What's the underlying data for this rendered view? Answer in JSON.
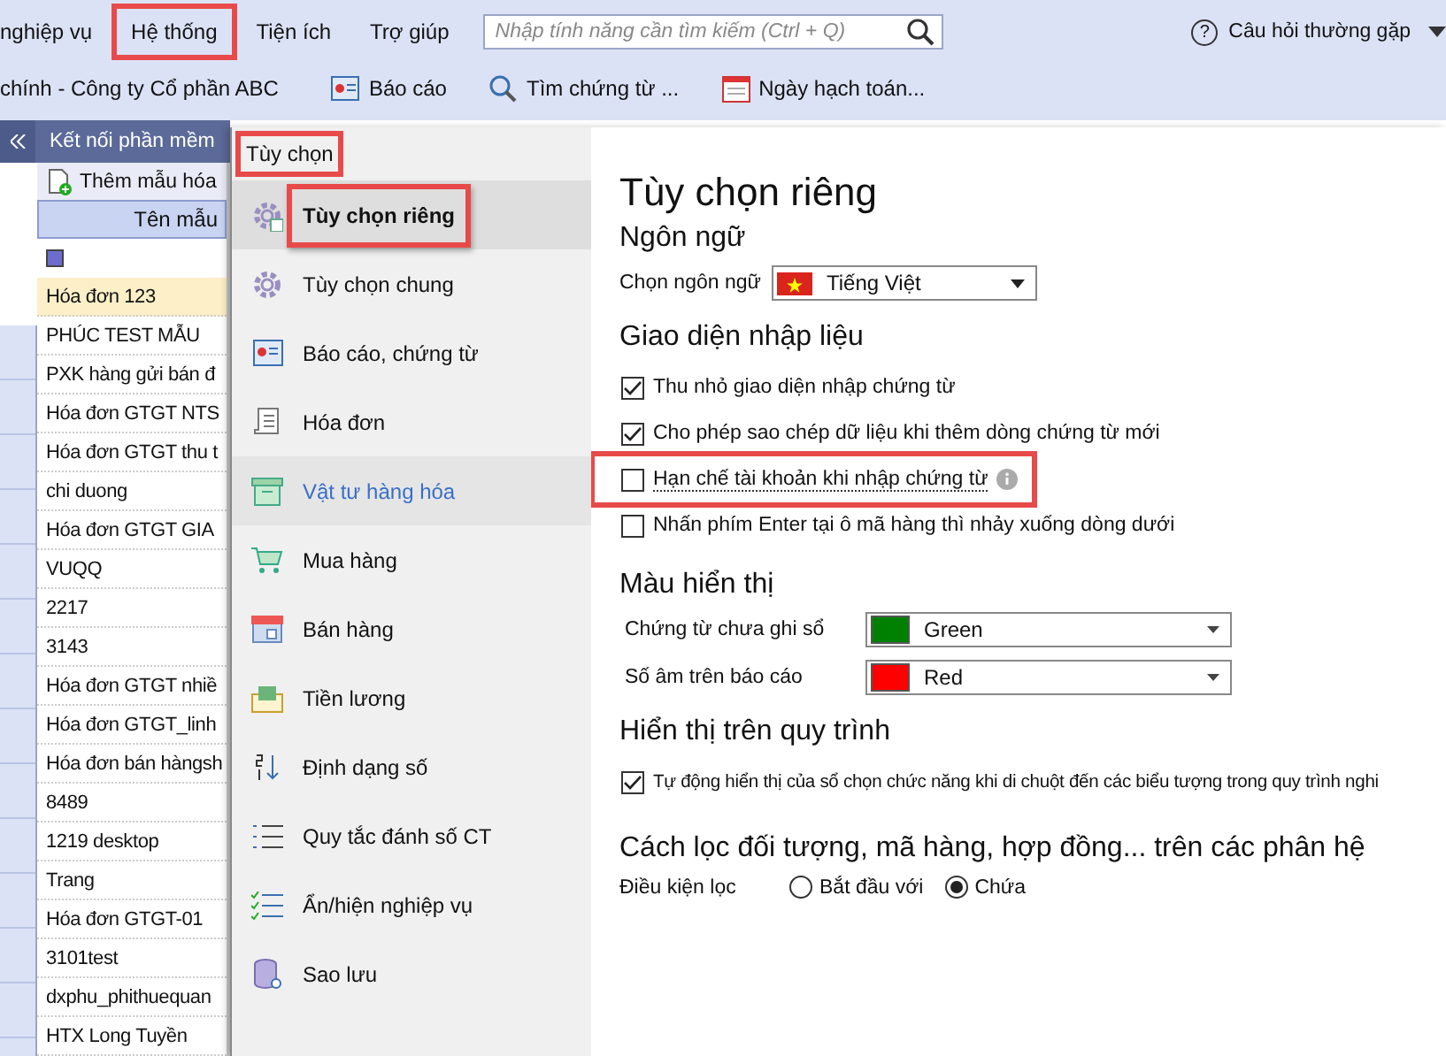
{
  "menu_bar": {
    "items": [
      {
        "label": "nghiệp vụ",
        "highlighted": false
      },
      {
        "label": "Hệ thống",
        "highlighted": true
      },
      {
        "label": "Tiện ích",
        "highlighted": false
      },
      {
        "label": "Trợ giúp",
        "highlighted": false
      }
    ],
    "search": {
      "placeholder": "Nhập tính năng cần tìm kiếm (Ctrl + Q)"
    },
    "help_icon": "?",
    "help": "Câu hỏi thường gặp"
  },
  "toolbar": {
    "company": "chính - Công ty Cổ phần ABC",
    "buttons": [
      {
        "kind": "report",
        "label": "Báo cáo"
      },
      {
        "kind": "search",
        "label": "Tìm chứng từ ..."
      },
      {
        "kind": "calendar",
        "label": "Ngày hạch toán..."
      }
    ]
  },
  "left_panel": {
    "tab": "Kết nối phần mềm",
    "add_button": "Thêm mẫu hóa",
    "column": "Tên mẫu",
    "filter_indeterminate": true,
    "rows": [
      {
        "name": "Hóa đơn 123",
        "selected": true
      },
      {
        "name": "PHÚC TEST MẪU",
        "selected": false
      },
      {
        "name": "PXK hàng gửi bán đ",
        "selected": false
      },
      {
        "name": "Hóa đơn GTGT NTS",
        "selected": false
      },
      {
        "name": "Hóa đơn GTGT thu t",
        "selected": false
      },
      {
        "name": "chi duong",
        "selected": false
      },
      {
        "name": "Hóa đơn GTGT GIA",
        "selected": false
      },
      {
        "name": "VUQQ",
        "selected": false
      },
      {
        "name": "2217",
        "selected": false
      },
      {
        "name": "3143",
        "selected": false
      },
      {
        "name": "Hóa đơn GTGT nhiề",
        "selected": false
      },
      {
        "name": "Hóa đơn GTGT_linh",
        "selected": false
      },
      {
        "name": "Hóa đơn bán hàngsh",
        "selected": false
      },
      {
        "name": "8489",
        "selected": false
      },
      {
        "name": "1219 desktop",
        "selected": false
      },
      {
        "name": "Trang",
        "selected": false
      },
      {
        "name": "Hóa đơn GTGT-01",
        "selected": false
      },
      {
        "name": "3101test",
        "selected": false
      },
      {
        "name": "dxphu_phithuequan",
        "selected": false
      },
      {
        "name": "HTX Long Tuyền",
        "selected": false
      }
    ]
  },
  "dialog": {
    "title": "Tùy chọn",
    "title_highlighted": true,
    "nav": [
      {
        "kind": "gear-user",
        "label": "Tùy chọn riêng",
        "selected": true,
        "hovered": false,
        "highlighted": true
      },
      {
        "kind": "gear",
        "label": "Tùy chọn chung",
        "selected": false,
        "hovered": false,
        "highlighted": false
      },
      {
        "kind": "report",
        "label": "Báo cáo, chứng từ",
        "selected": false,
        "hovered": false,
        "highlighted": false
      },
      {
        "kind": "invoice",
        "label": "Hóa đơn",
        "selected": false,
        "hovered": false,
        "highlighted": false
      },
      {
        "kind": "box",
        "label": "Vật tư hàng hóa",
        "selected": false,
        "hovered": true,
        "highlighted": false
      },
      {
        "kind": "cart",
        "label": "Mua hàng",
        "selected": false,
        "hovered": false,
        "highlighted": false
      },
      {
        "kind": "shop",
        "label": "Bán hàng",
        "selected": false,
        "hovered": false,
        "highlighted": false
      },
      {
        "kind": "envelope",
        "label": "Tiền lương",
        "selected": false,
        "hovered": false,
        "highlighted": false
      },
      {
        "kind": "sort",
        "label": "Định dạng số",
        "selected": false,
        "hovered": false,
        "highlighted": false
      },
      {
        "kind": "numbered",
        "label": "Quy tắc đánh số CT",
        "selected": false,
        "hovered": false,
        "highlighted": false
      },
      {
        "kind": "checklist",
        "label": "Ẩn/hiện nghiệp vụ",
        "selected": false,
        "hovered": false,
        "highlighted": false
      },
      {
        "kind": "database",
        "label": "Sao lưu",
        "selected": false,
        "hovered": false,
        "highlighted": false
      }
    ],
    "page_title": "Tùy chọn riêng",
    "language": {
      "heading": "Ngôn ngữ",
      "label": "Chọn ngôn ngữ",
      "value": "Tiếng Việt"
    },
    "input_ui": {
      "heading": "Giao diện nhập liệu",
      "options": [
        {
          "label": "Thu nhỏ giao diện nhập chứng từ",
          "checked": true,
          "info": false,
          "highlighted": false
        },
        {
          "label": "Cho phép sao chép dữ liệu khi thêm dòng chứng từ mới",
          "checked": true,
          "info": false,
          "highlighted": false
        },
        {
          "label": "Hạn chế tài khoản khi nhập chứng từ",
          "checked": false,
          "info": true,
          "highlighted": true
        },
        {
          "label": "Nhấn phím Enter tại ô mã hàng thì nhảy xuống dòng dưới",
          "checked": false,
          "info": false,
          "highlighted": false
        }
      ]
    },
    "display_colors": {
      "heading": "Màu hiển thị",
      "rows": [
        {
          "label": "Chứng từ chưa ghi sổ",
          "value": "Green",
          "color": "#008000"
        },
        {
          "label": "Số âm trên báo cáo",
          "value": "Red",
          "color": "#ff0000"
        }
      ]
    },
    "process": {
      "heading": "Hiển thị trên quy trình",
      "options": [
        {
          "label": "Tự động hiển thị của sổ chọn chức năng khi di chuột đến các biểu tượng trong quy trình nghi",
          "checked": true
        }
      ]
    },
    "filter": {
      "heading": "Cách lọc đối tượng, mã hàng, hợp đồng... trên các phân hệ",
      "label": "Điều kiện lọc",
      "options": [
        {
          "label": "Bắt đầu với",
          "selected": false
        },
        {
          "label": "Chứa",
          "selected": true
        }
      ]
    }
  }
}
